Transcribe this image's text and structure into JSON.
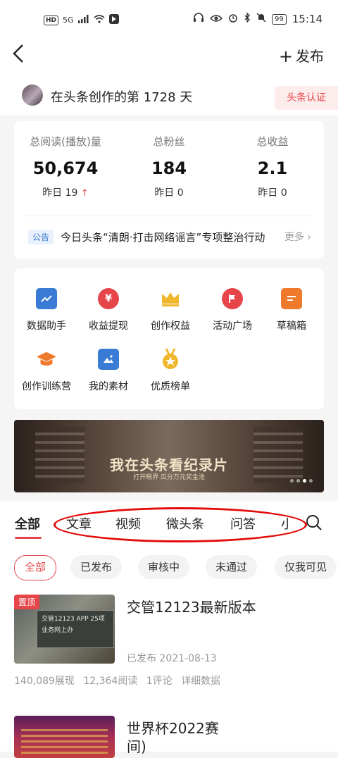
{
  "status_bar": {
    "net_tags": [
      "HD",
      "5G"
    ],
    "battery": "99",
    "time": "15:14"
  },
  "nav": {
    "back_icon": "chevron-left-icon",
    "publish_label": "发布"
  },
  "profile": {
    "creator_text": "在头条创作的第 1728 天",
    "cert_label": "头条认证"
  },
  "stats": [
    {
      "label": "总阅读(播放)量",
      "value": "50,674",
      "sub": "昨日 19"
    },
    {
      "label": "总粉丝",
      "value": "184",
      "sub": "昨日 0"
    },
    {
      "label": "总收益",
      "value": "2.1",
      "sub": "昨日 0"
    }
  ],
  "notice": {
    "tag": "公告",
    "text": "今日头条“清朗·打击网络谣言”专项整治行动",
    "more": "更多"
  },
  "tools": [
    {
      "label": "数据助手",
      "icon": "chart-icon",
      "color": "#3a7bd5"
    },
    {
      "label": "收益提现",
      "icon": "yuan-icon",
      "color": "#e6454a"
    },
    {
      "label": "创作权益",
      "icon": "crown-icon",
      "color": "#f0b62c"
    },
    {
      "label": "活动广场",
      "icon": "flag-icon",
      "color": "#e6454a"
    },
    {
      "label": "草稿箱",
      "icon": "draft-icon",
      "color": "#f07a2c"
    },
    {
      "label": "创作训练营",
      "icon": "graduation-cap-icon",
      "color": "#f07a2c"
    },
    {
      "label": "我的素材",
      "icon": "image-icon",
      "color": "#3a7bd5"
    },
    {
      "label": "优质榜单",
      "icon": "medal-icon",
      "color": "#f0b62c"
    }
  ],
  "banner": {
    "title": "我在头条看纪录片",
    "subtitle": "打开眼界  瓜分万元奖金池"
  },
  "tabs": [
    "全部",
    "文章",
    "视频",
    "微头条",
    "问答",
    "小"
  ],
  "filters": [
    "全部",
    "已发布",
    "审核中",
    "未通过",
    "仅我可见"
  ],
  "articles": [
    {
      "pin": "置顶",
      "title": "交管12123最新版本",
      "thumb_text": "交管12123 APP 25项业务网上办",
      "status": "已发布",
      "date": "2021-08-13",
      "impressions": "140,089展现",
      "reads": "12,364阅读",
      "comments": "1评论",
      "detail": "详细数据"
    },
    {
      "title": "世界杯2022赛",
      "title_line2": "间)"
    }
  ],
  "colors": {
    "accent": "#e6454a",
    "annotation": "#e30b0b"
  }
}
